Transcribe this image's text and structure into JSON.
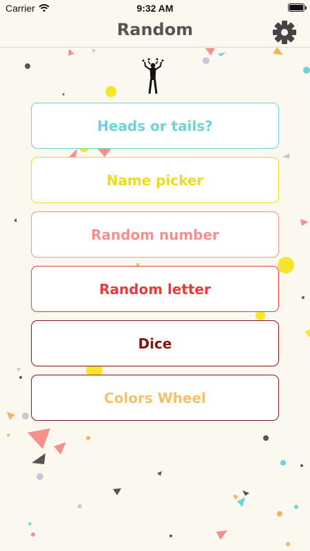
{
  "status_bar": {
    "carrier": "Carrier",
    "time": "9:32 AM"
  },
  "nav": {
    "title": "Random",
    "settings_icon": "gear-icon"
  },
  "menu": [
    {
      "label": "Heads or tails?",
      "color": "#6dd3d6",
      "border": "#6dd3d6"
    },
    {
      "label": "Name picker",
      "color": "#ecdc1a",
      "border": "#ecdc1a"
    },
    {
      "label": "Random number",
      "color": "#f4918e",
      "border": "#f4918e"
    },
    {
      "label": "Random letter",
      "color": "#e83a3a",
      "border": "#e83a3a"
    },
    {
      "label": "Dice",
      "color": "#8b1212",
      "border": "#8b1212"
    },
    {
      "label": "Colors Wheel",
      "color": "#f5c16c",
      "border": "#7a1b1b"
    }
  ],
  "colors": {
    "background": "#fbf8ef",
    "confetti": [
      "#f7e52b",
      "#6dd3d6",
      "#f4918e",
      "#555555",
      "#cfc4d6",
      "#f5b35a"
    ]
  }
}
